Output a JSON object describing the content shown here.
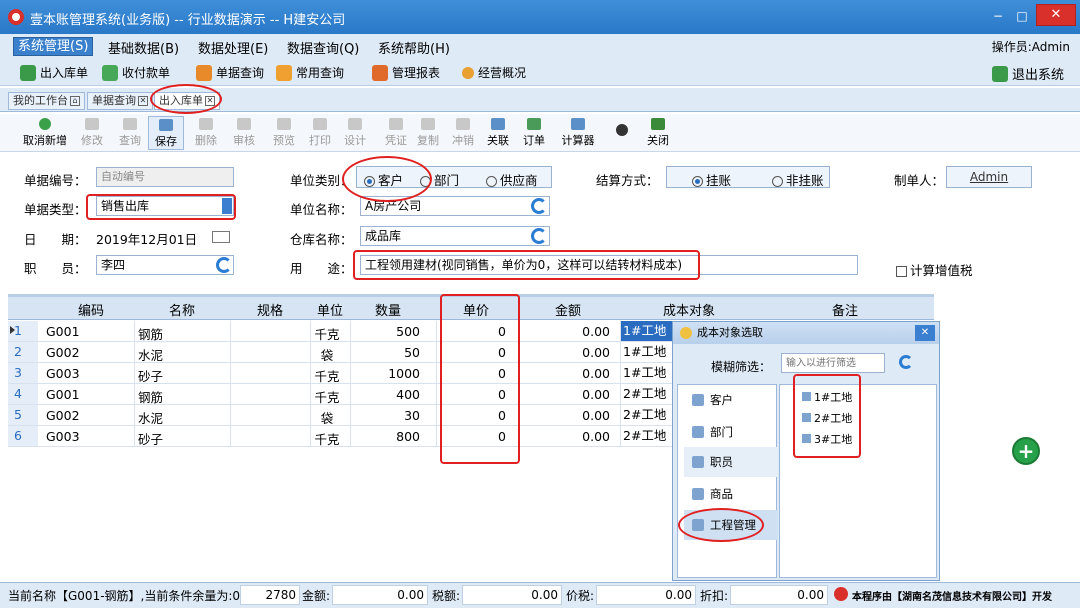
{
  "window": {
    "title": "壹本账管理系统(业务版) -- 行业数据演示 -- H建安公司",
    "minimize": "−",
    "maximize": "□",
    "close": "✕"
  },
  "menu": {
    "items": [
      "系统管理(S)",
      "基础数据(B)",
      "数据处理(E)",
      "数据查询(Q)",
      "系统帮助(H)"
    ],
    "operator": "操作员:Admin"
  },
  "quickbar": {
    "items": [
      "出入库单",
      "收付款单",
      "单据查询",
      "常用查询",
      "管理报表",
      "经营概况"
    ],
    "exit": "退出系统"
  },
  "tabs": [
    "我的工作台",
    "单据查询",
    "出入库单"
  ],
  "toolbar": [
    "取消新增",
    "修改",
    "查询",
    "保存",
    "删除",
    "审核",
    "预览",
    "打印",
    "设计",
    "凭证",
    "复制",
    "冲销",
    "关联",
    "订单",
    "计算器",
    "",
    "关闭"
  ],
  "form": {
    "doc_no_label": "单据编号：",
    "doc_no_value": "自动编号",
    "doc_type_label": "单据类型：",
    "doc_type_value": "销售出库",
    "date_label": "日　　期：",
    "date_value": "2019年12月01日",
    "staff_label": "职　　员：",
    "staff_value": "李四",
    "unit_type_label": "单位类别：",
    "unit_types": [
      "客户",
      "部门",
      "供应商"
    ],
    "unit_name_label": "单位名称：",
    "unit_name_value": "A房产公司",
    "warehouse_label": "仓库名称：",
    "warehouse_value": "成品库",
    "purpose_label": "用　　途：",
    "purpose_value": "工程领用建材(视同销售，单价为0，这样可以结转材料成本)",
    "settle_label": "结算方式：",
    "settle_options": [
      "挂账",
      "非挂账"
    ],
    "maker_label": "制单人：",
    "maker_value": "Admin",
    "vat_label": "计算增值税"
  },
  "grid": {
    "headers": [
      "编码",
      "名称",
      "规格",
      "单位",
      "数量",
      "单价",
      "金额",
      "成本对象",
      "备注"
    ],
    "rows": [
      {
        "no": "1",
        "code": "G001",
        "name": "钢筋",
        "unit": "千克",
        "qty": "500",
        "price": "0",
        "amount": "0.00",
        "cost": "1#工地"
      },
      {
        "no": "2",
        "code": "G002",
        "name": "水泥",
        "unit": "袋",
        "qty": "50",
        "price": "0",
        "amount": "0.00",
        "cost": "1#工地"
      },
      {
        "no": "3",
        "code": "G003",
        "name": "砂子",
        "unit": "千克",
        "qty": "1000",
        "price": "0",
        "amount": "0.00",
        "cost": "1#工地"
      },
      {
        "no": "4",
        "code": "G001",
        "name": "钢筋",
        "unit": "千克",
        "qty": "400",
        "price": "0",
        "amount": "0.00",
        "cost": "2#工地"
      },
      {
        "no": "5",
        "code": "G002",
        "name": "水泥",
        "unit": "袋",
        "qty": "30",
        "price": "0",
        "amount": "0.00",
        "cost": "2#工地"
      },
      {
        "no": "6",
        "code": "G003",
        "name": "砂子",
        "unit": "千克",
        "qty": "800",
        "price": "0",
        "amount": "0.00",
        "cost": "2#工地"
      }
    ]
  },
  "popup": {
    "title": "成本对象选取",
    "filter_label": "模糊筛选：",
    "filter_placeholder": "输入以进行筛选",
    "types": [
      "客户",
      "部门",
      "职员",
      "商品",
      "工程管理"
    ],
    "items": [
      "1#工地",
      "2#工地",
      "3#工地"
    ]
  },
  "status": {
    "current": "当前名称【G001-钢筋】,当前条件余量为:0",
    "qty_total": "2780",
    "amount_label": "金额:",
    "amount": "0.00",
    "tax_label": "税额:",
    "tax": "0.00",
    "total_label": "价税:",
    "total": "0.00",
    "discount_label": "折扣:",
    "discount": "0.00",
    "copyright": "本程序由【湖南名茂信息技术有限公司】开发"
  },
  "colors": {
    "accent": "#2a78c8",
    "annotation": "#e02020",
    "add_button": "#27a04a"
  }
}
